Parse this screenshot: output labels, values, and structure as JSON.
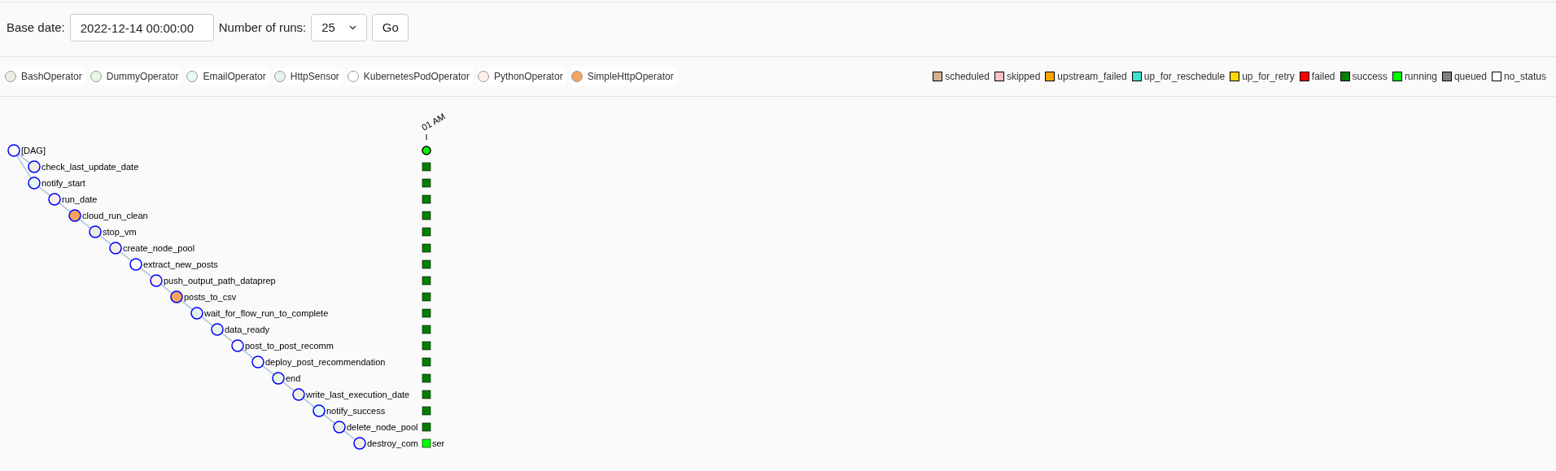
{
  "form": {
    "base_date_label": "Base date:",
    "base_date": "2022-12-14 00:00:00",
    "runs_label": "Number of runs:",
    "runs": "25",
    "go": "Go"
  },
  "operators": [
    {
      "name": "BashOperator",
      "color": "#f0ede4"
    },
    {
      "name": "DummyOperator",
      "color": "#e8f7e4"
    },
    {
      "name": "EmailOperator",
      "color": "#e6faf9"
    },
    {
      "name": "HttpSensor",
      "color": "#e6f1f2"
    },
    {
      "name": "KubernetesPodOperator",
      "color": "#ffffff"
    },
    {
      "name": "PythonOperator",
      "color": "#ffefeb"
    },
    {
      "name": "SimpleHttpOperator",
      "color": "#f4a460"
    }
  ],
  "states": [
    {
      "name": "scheduled",
      "color": "#d2b48c"
    },
    {
      "name": "skipped",
      "color": "#ffc0cb"
    },
    {
      "name": "upstream_failed",
      "color": "#ffa500"
    },
    {
      "name": "up_for_reschedule",
      "color": "#40e0d0"
    },
    {
      "name": "up_for_retry",
      "color": "#ffd700"
    },
    {
      "name": "failed",
      "color": "#ff0000"
    },
    {
      "name": "success",
      "color": "#008000"
    },
    {
      "name": "running",
      "color": "#00ff00"
    },
    {
      "name": "queued",
      "color": "#808080"
    },
    {
      "name": "no_status",
      "color": "#ffffff"
    }
  ],
  "run": {
    "time_label": "01 AM"
  },
  "tree": {
    "label": "[DAG]",
    "color": "#ffffff",
    "run_status": {
      "color": "#00ff00"
    },
    "children": [
      {
        "label": "check_last_update_date",
        "color": "#f0ede4",
        "run_status": {
          "color": "#008000"
        }
      },
      {
        "label": "notify_start",
        "color": "#e6faf9",
        "run_status": {
          "color": "#008000"
        },
        "children": [
          {
            "label": "run_date",
            "color": "#ffefeb",
            "run_status": {
              "color": "#008000"
            },
            "children": [
              {
                "label": "cloud_run_clean",
                "color": "#f4a460",
                "run_status": {
                  "color": "#008000"
                },
                "children": [
                  {
                    "label": "stop_vm",
                    "color": "#f0ede4",
                    "run_status": {
                      "color": "#008000"
                    },
                    "children": [
                      {
                        "label": "create_node_pool",
                        "color": "#f0ede4",
                        "run_status": {
                          "color": "#008000"
                        },
                        "children": [
                          {
                            "label": "extract_new_posts",
                            "color": "#ffffff",
                            "run_status": {
                              "color": "#008000"
                            },
                            "children": [
                              {
                                "label": "push_output_path_dataprep",
                                "color": "#ffefeb",
                                "run_status": {
                                  "color": "#008000"
                                },
                                "children": [
                                  {
                                    "label": "posts_to_csv",
                                    "color": "#f4a460",
                                    "run_status": {
                                      "color": "#008000"
                                    },
                                    "children": [
                                      {
                                        "label": "wait_for_flow_run_to_complete",
                                        "color": "#e6f1f2",
                                        "run_status": {
                                          "color": "#008000"
                                        },
                                        "children": [
                                          {
                                            "label": "data_ready",
                                            "color": "#e8f7e4",
                                            "run_status": {
                                              "color": "#008000"
                                            },
                                            "children": [
                                              {
                                                "label": "post_to_post_recomm",
                                                "color": "#ffffff",
                                                "run_status": {
                                                  "color": "#008000"
                                                },
                                                "children": [
                                                  {
                                                    "label": "deploy_post_recommendation",
                                                    "color": "#ffffff",
                                                    "run_status": {
                                                      "color": "#008000"
                                                    },
                                                    "children": [
                                                      {
                                                        "label": "end",
                                                        "color": "#e8f7e4",
                                                        "run_status": {
                                                          "color": "#008000"
                                                        },
                                                        "children": [
                                                          {
                                                            "label": "write_last_execution_date",
                                                            "color": "#f0ede4",
                                                            "run_status": {
                                                              "color": "#008000"
                                                            },
                                                            "children": [
                                                              {
                                                                "label": "notify_success",
                                                                "color": "#e6faf9",
                                                                "run_status": {
                                                                  "color": "#008000"
                                                                },
                                                                "children": [
                                                                  {
                                                                    "label": "delete_node_pool",
                                                                    "color": "#f0ede4",
                                                                    "run_status": {
                                                                      "color": "#008000"
                                                                    },
                                                                    "children": [
                                                                      {
                                                                        "label": "destroy_com",
                                                                        "label_tail": "ser",
                                                                        "color": "#f0ede4",
                                                                        "run_status": {
                                                                          "color": "#00ff00"
                                                                        }
                                                                      }
                                                                    ]
                                                                  }
                                                                ]
                                                              }
                                                            ]
                                                          }
                                                        ]
                                                      }
                                                    ]
                                                  }
                                                ]
                                              }
                                            ]
                                          }
                                        ]
                                      }
                                    ]
                                  }
                                ]
                              }
                            ]
                          }
                        ]
                      }
                    ]
                  }
                ]
              }
            ]
          }
        ]
      }
    ]
  }
}
